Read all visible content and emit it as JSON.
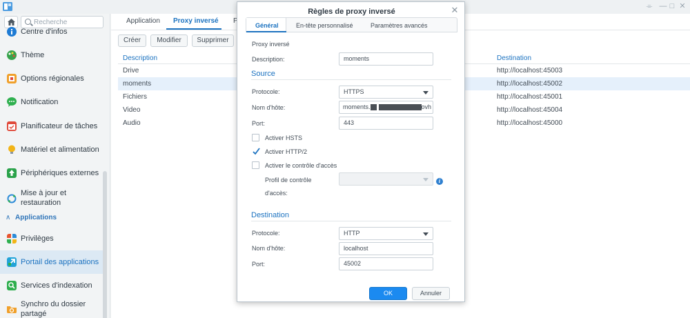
{
  "window": {
    "controls": [
      "—",
      "□",
      "✕"
    ]
  },
  "sidebar": {
    "search_placeholder": "Recherche",
    "items": [
      {
        "label": "Centre d'infos",
        "icon": "info-icon",
        "color": "#1e7bd4"
      },
      {
        "label": "Thème",
        "icon": "palette-icon",
        "color": "#37a34b"
      },
      {
        "label": "Options régionales",
        "icon": "regional-options-icon",
        "color": "#f0a02b"
      },
      {
        "label": "Notification",
        "icon": "notification-bubble-icon",
        "color": "#2fb04f"
      },
      {
        "label": "Planificateur de tâches",
        "icon": "calendar-icon",
        "color": "#e04a3b"
      },
      {
        "label": "Matériel et alimentation",
        "icon": "lightbulb-icon",
        "color": "#f2b417"
      },
      {
        "label": "Périphériques externes",
        "icon": "external-device-icon",
        "color": "#2aa24a"
      },
      {
        "label1": "Mise à jour et",
        "label2": "restauration",
        "icon": "update-icon",
        "color": "#2c8bd8"
      }
    ],
    "section_label": "Applications",
    "app_items": [
      {
        "label": "Privilèges",
        "icon": "privileges-grid-icon",
        "color": "#e8542f"
      },
      {
        "label": "Portail des applications",
        "icon": "application-portal-icon",
        "color": "#21a3d8"
      },
      {
        "label": "Services d'indexation",
        "icon": "indexing-search-icon",
        "color": "#2eae4d"
      },
      {
        "label1": "Synchro du dossier",
        "label2": "partagé",
        "icon": "shared-folder-sync-icon",
        "color": "#f0a02b"
      }
    ]
  },
  "main": {
    "tabs": [
      "Application",
      "Proxy inversé",
      "P"
    ],
    "buttons": {
      "create": "Créer",
      "edit": "Modifier",
      "delete": "Supprimer"
    },
    "columns": {
      "description": "Description",
      "destination": "Destination"
    },
    "rows": [
      {
        "description": "Drive",
        "destination": "http://localhost:45003"
      },
      {
        "description": "moments",
        "destination": "http://localhost:45002"
      },
      {
        "description": "Fichiers",
        "destination": "http://localhost:45001"
      },
      {
        "description": "Video",
        "destination": "http://localhost:45004"
      },
      {
        "description": "Audio",
        "destination": "http://localhost:45000"
      }
    ]
  },
  "dialog": {
    "title": "Règles de proxy inversé",
    "tabs": [
      "Général",
      "En-tête personnalisé",
      "Paramètres avancés"
    ],
    "intro": "Proxy inversé",
    "description_label": "Description:",
    "description_value": "moments",
    "source": {
      "heading": "Source",
      "protocol_label": "Protocole:",
      "protocol_value": "HTTPS",
      "hostname_label": "Nom d'hôte:",
      "hostname_prefix": "moments.",
      "hostname_suffix": "ovh",
      "port_label": "Port:",
      "port_value": "443",
      "hsts_label": "Activer HSTS",
      "http2_label": "Activer HTTP/2",
      "access_control_label": "Activer le contrôle d'accès",
      "profile_label1": "Profil de contrôle",
      "profile_label2": "d'accès:"
    },
    "destination": {
      "heading": "Destination",
      "protocol_label": "Protocole:",
      "protocol_value": "HTTP",
      "hostname_label": "Nom d'hôte:",
      "hostname_value": "localhost",
      "port_label": "Port:",
      "port_value": "45002"
    },
    "ok_label": "OK",
    "cancel_label": "Annuler"
  }
}
